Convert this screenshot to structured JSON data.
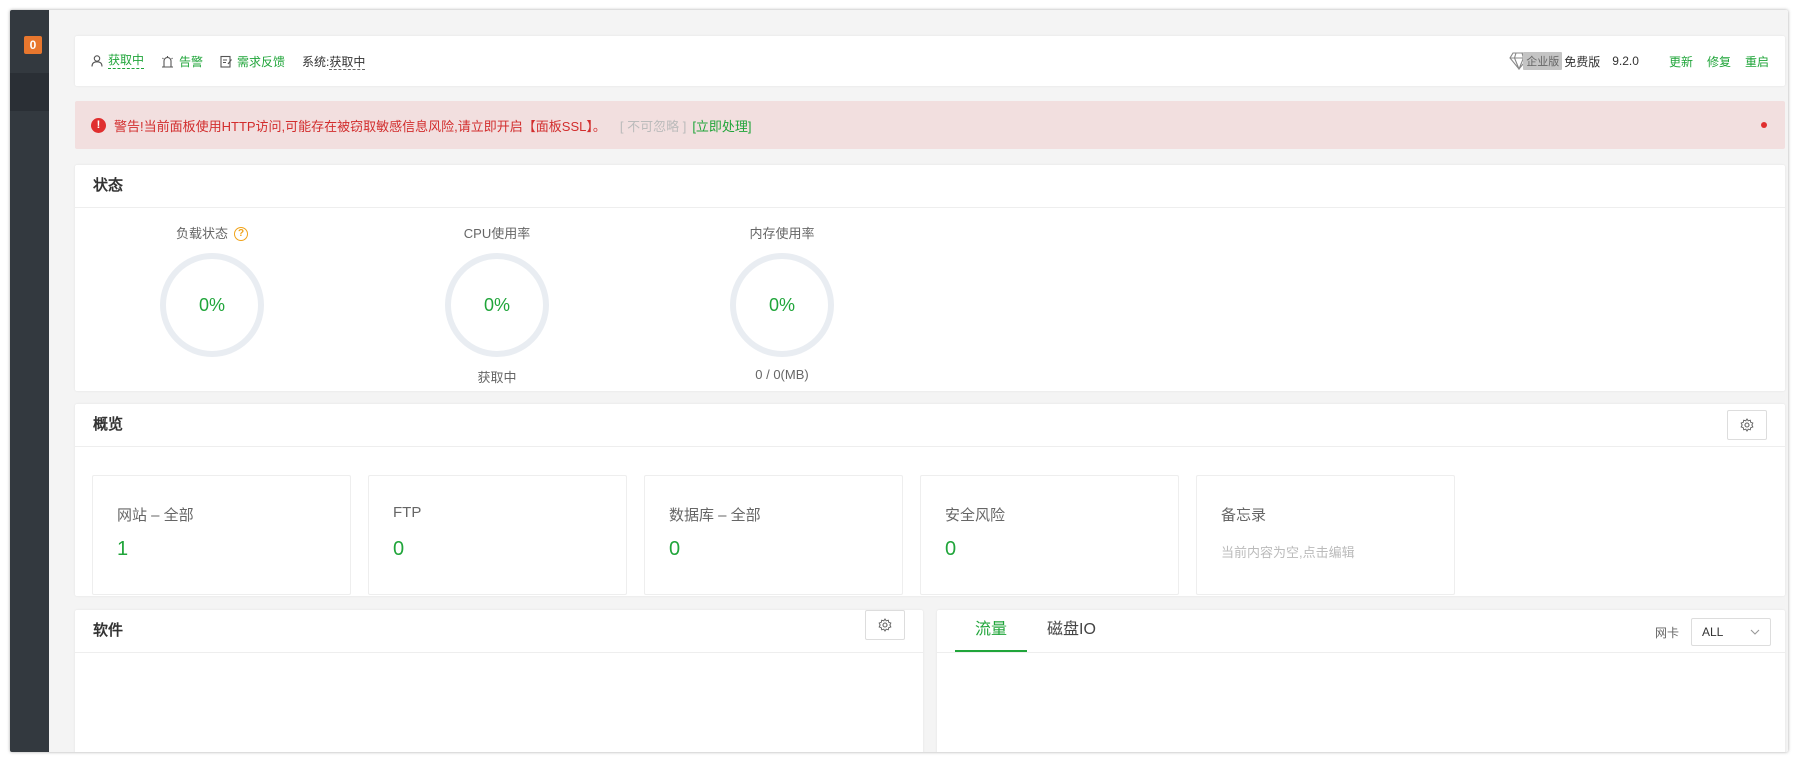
{
  "sidebar": {
    "badge": "0"
  },
  "topbar": {
    "user_status": "获取中",
    "alert": "告警",
    "feedback": "需求反馈",
    "system_label": "系统:",
    "system_value": "获取中",
    "enterprise": "企业版",
    "free": "免费版",
    "version": "9.2.0",
    "update": "更新",
    "repair": "修复",
    "restart": "重启"
  },
  "warning": {
    "icon": "!",
    "text": "警告!当前面板使用HTTP访问,可能存在被窃取敏感信息风险,请立即开启【面板SSL】。",
    "ignore": "[ 不可忽略 ]",
    "action": "[立即处理]"
  },
  "status": {
    "title": "状态",
    "gauges": [
      {
        "title": "负载状态",
        "value": "0%",
        "sub": "",
        "help": "?"
      },
      {
        "title": "CPU使用率",
        "value": "0%",
        "sub": "获取中"
      },
      {
        "title": "内存使用率",
        "value": "0%",
        "sub": "0 / 0(MB)"
      }
    ]
  },
  "overview": {
    "title": "概览",
    "boxes": [
      {
        "label": "网站 – 全部",
        "value": "1"
      },
      {
        "label": "FTP",
        "value": "0"
      },
      {
        "label": "数据库 – 全部",
        "value": "0"
      },
      {
        "label": "安全风险",
        "value": "0"
      },
      {
        "label": "备忘录",
        "note": "当前内容为空,点击编辑"
      }
    ]
  },
  "software": {
    "title": "软件"
  },
  "traffic": {
    "tabs": [
      "流量",
      "磁盘IO"
    ],
    "nic_label": "网卡",
    "nic_value": "ALL"
  },
  "colors": {
    "accent": "#20a53a",
    "warning_red": "#d22d2d",
    "sidebar": "#33393f",
    "badge": "#e8772e"
  }
}
